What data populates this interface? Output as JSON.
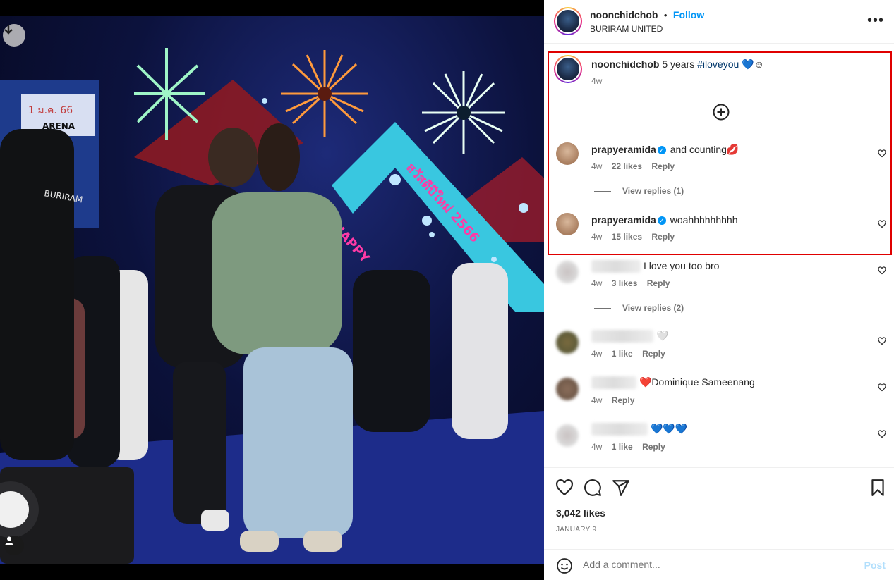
{
  "photo": {
    "sign_text": "สวัสดีปีใหม่ 2566",
    "banner_text": "1 ม.ค. 66",
    "arena_text": "ARENA",
    "happy_text": "HAPPY",
    "jacket_text": "BURIRAM"
  },
  "header": {
    "username": "noonchidchob",
    "separator": "•",
    "follow_label": "Follow",
    "location": "BURIRAM UNITED",
    "more_label": "•••"
  },
  "caption": {
    "username": "noonchidchob",
    "text": "5 years",
    "hashtag": "#iloveyou",
    "emoji": "💙☺",
    "time": "4w"
  },
  "comments": [
    {
      "username": "prapyeramida",
      "verified": true,
      "text": "and counting💋",
      "time": "4w",
      "likes": "22 likes",
      "reply": "Reply",
      "view_replies": "View replies (1)"
    },
    {
      "username": "prapyeramida",
      "verified": true,
      "text": "woahhhhhhhhh",
      "time": "4w",
      "likes": "15 likes",
      "reply": "Reply"
    },
    {
      "username": "",
      "text": "I love you too bro",
      "time": "4w",
      "likes": "3 likes",
      "reply": "Reply",
      "view_replies": "View replies (2)"
    },
    {
      "username": "",
      "text": "🤍",
      "time": "4w",
      "likes": "1 like",
      "reply": "Reply"
    },
    {
      "username": "",
      "text": "❤️Dominique Sameenang",
      "time": "4w",
      "reply": "Reply"
    },
    {
      "username": "",
      "text": "💙💙💙",
      "time": "4w",
      "likes": "1 like",
      "reply": "Reply"
    }
  ],
  "footer": {
    "likes": "3,042 likes",
    "date": "JANUARY 9",
    "comment_placeholder": "Add a comment...",
    "post_label": "Post"
  },
  "colors": {
    "accent": "#0095f6",
    "highlight_border": "#e00000",
    "post_disabled": "#b2dffc"
  }
}
